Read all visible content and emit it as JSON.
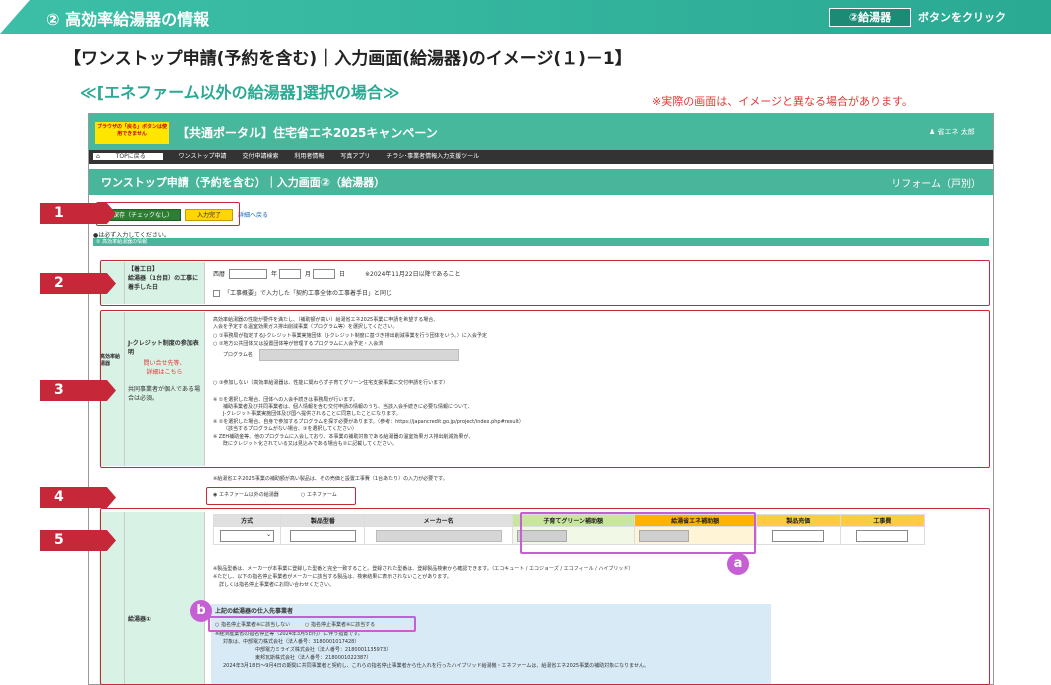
{
  "top_bar": {
    "title": "② 高効率給湯器の情報",
    "button_label": "②給湯器",
    "button_suffix": "ボタンをクリック"
  },
  "heading": "【ワンストップ申請(予約を含む)｜入力画面(給湯器)のイメージ(１)－1】",
  "subheading": "≪[エネファーム以外の給湯器]選択の場合≫",
  "note": "※実際の画面は、イメージと異なる場合があります。",
  "portal": {
    "warning": "ブラウザの「戻る」ボタンは使用できません",
    "title": "【共通ポータル】住宅省エネ2025キャンペーン",
    "user": "省エネ 太郎",
    "nav": [
      "TOPに戻る",
      "ワンストップ申請",
      "交付申請検索",
      "利用者情報",
      "写真アプリ",
      "チラシ･事業者情報入力支援ツール"
    ],
    "page_title": "ワンストップ申請（予約を含む）｜入力画面②（給湯器）",
    "page_right": "リフォーム（戸別）",
    "btn_save": "仮保存（チェックなし）",
    "btn_done": "入力完了",
    "back_link": "詳細へ戻る",
    "required_note": "●は必ず入力してください。",
    "section_bar": "② 高効率給湯器の情報",
    "start_date": {
      "label_title": "【着工日】",
      "label_body": "給湯器（1台目）の工事に着手した日",
      "era": "西暦",
      "year": "年",
      "month": "月",
      "day": "日",
      "hint": "※2024年11月22日以降であること",
      "checkbox_text": "「工事概要」で入力した「契約工事全体の工事着手日」と同じ"
    },
    "jcredit": {
      "group_label": "高効率給湯器",
      "label": "J-クレジット制度の参加表明",
      "red_link1": "問い合せ先等、",
      "red_link2": "詳細はこちら",
      "side_note": "共同事業者が個人である場合は必須。",
      "intro1": "高効率給湯器の性能が要件を満たし、（補助額が高い）給湯省エネ2025事業に申請を希望する場合、",
      "intro2": "入会を予定する温室効果ガス排出削減事業（プログラム等）を選択してください。",
      "opt1": "①事務局が指定するJ-クレジット事業実施団体（J-クレジット制度に基づき排出削減事業を行う団体をいう。）に入会予定",
      "opt2": "②地方公共団体又は設置団体等が管理するプログラムに入会予定・入会済",
      "program_label": "プログラム名",
      "opt3": "③参加しない（高効率給湯器は、性能に関わらず子育てグリーン住宅支援事業に交付申請を行います）",
      "note1": "※ ①を選択した場合、団体への入会手続きは事務局が行います。",
      "note2": "補助事業者及び共同事業者は、個人情報を含む交付申請の情報のうち、当該入会手続きに必要な情報について、",
      "note3": "J-クレジット事業実施団体及び国へ提供されることに同意したことになります。",
      "note4": "※ ②を選択した場合、自身で参加するプログラムを探す必要があります。（参考：https://japancredit.go.jp/project/index.php#result）",
      "note5": "（該当するプログラムがない場合、③を選択してください）",
      "note6": "※ ZEH補助金等、他のプログラムに入会しており、本事業の補助対象である給湯器の温室効果ガス排出削減効果が、",
      "note7": "既にクレジット化されている又は見込みである場合も②に記載してください。"
    },
    "type_select": {
      "note": "※給湯省エネ2025事業の補助額が高い製品は、その売価と設置工事費（1台あたり）の入力が必要です。",
      "opt_other": "エネファーム以外の給湯器",
      "opt_enefarm": "エネファーム"
    },
    "product": {
      "row_label": "給湯器①",
      "headers": [
        "方式",
        "製品型番",
        "メーカー名",
        "子育てグリーン補助額",
        "給湯省エネ補助額",
        "製品売価",
        "工事費"
      ],
      "note1": "※製品型番は、メーカーが本事業に登録した型番と完全一致すること。登録された型番は、登録製品検索から確認できます。（エコキュート / エコジョーズ / エコフィール / ハイブリッド）",
      "note2": "※ただし、以下の指名停止事業者がメーカーに該当する製品は、検索結果に表示されないことがあります。",
      "note3": "詳しくは指名停止事業者にお問い合わせください。",
      "supplier_title": "上記の給湯器の仕入先事業者",
      "radio1": "指名停止事業者※に該当しない",
      "radio2": "指名停止事業者※に該当する",
      "supp_note1": "※経済産業省の指名停止等（2024年3月5日付）に伴う措置です。",
      "supp_note2": "対象は、中部電力株式会社（法人番号：3180001017428）",
      "supp_note3": "中部電力ミライズ株式会社（法人番号：2180001135973）",
      "supp_note4": "東邦瓦斯株式会社（法人番号：2180001022387）",
      "supp_note5": "2024年3月18日～9月4日の期間に共同事業者と契約し、これらの指名停止事業者から仕入れを行ったハイブリッド給湯機・エネファームは、給湯省エネ2025事業の補助対象になりません。"
    }
  },
  "callouts": {
    "labels": [
      "1",
      "2",
      "3",
      "4",
      "5"
    ],
    "circles": [
      "a",
      "b"
    ]
  },
  "colors": {
    "teal": "#3dbfa7",
    "red": "#c62839",
    "purple": "#c55fd3"
  }
}
